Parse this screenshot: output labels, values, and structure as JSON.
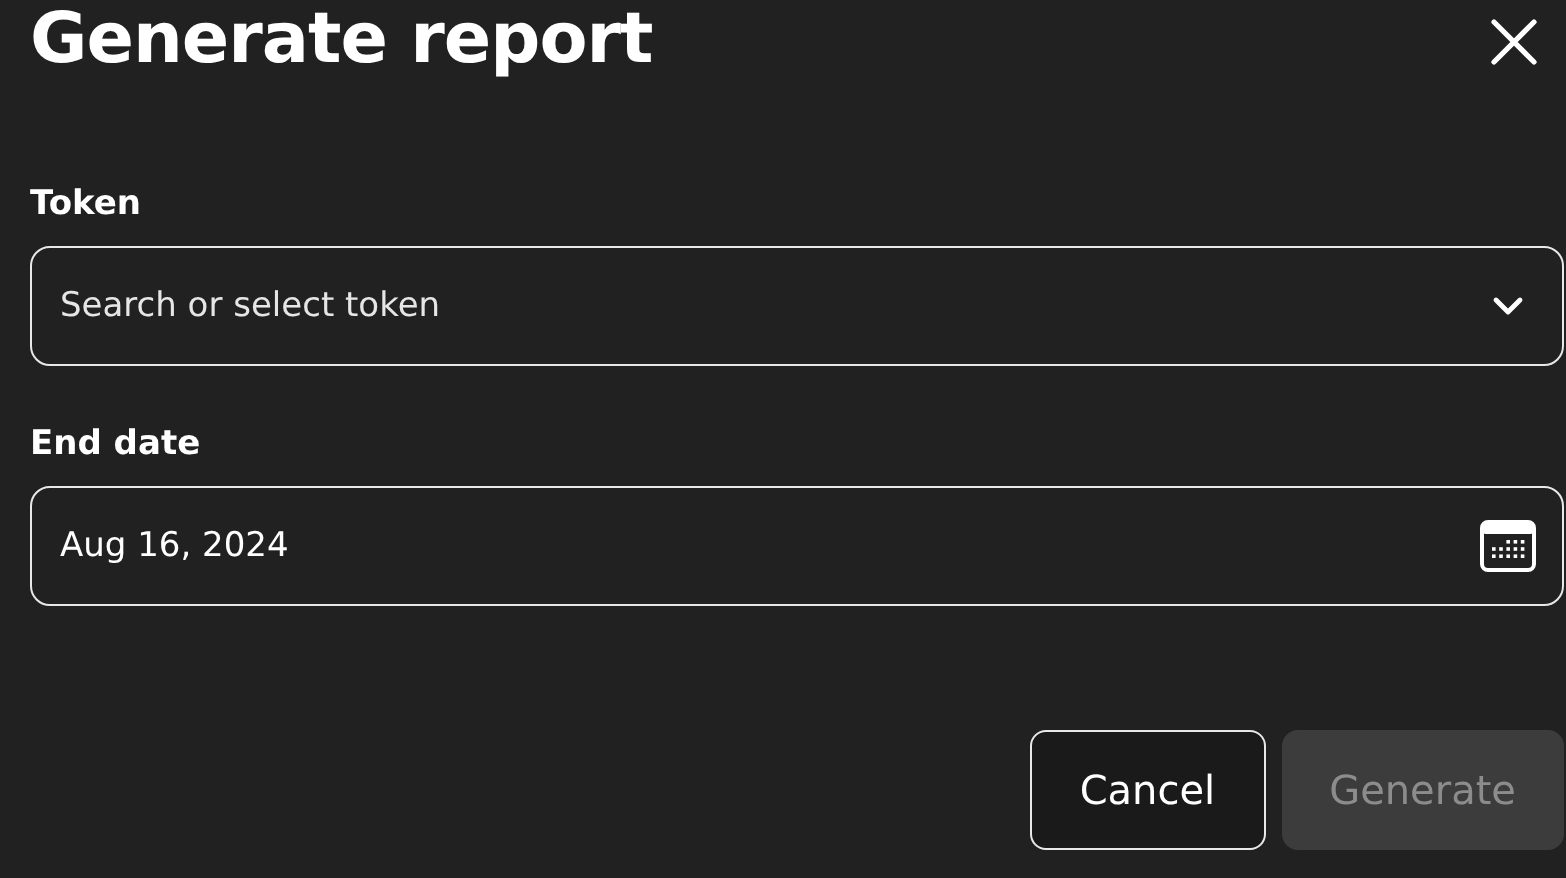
{
  "dialog": {
    "title": "Generate report",
    "fields": [
      {
        "kind": "select",
        "label": "Token",
        "placeholder": "Search or select token"
      },
      {
        "kind": "date",
        "label": "End date",
        "value": "Aug 16, 2024"
      }
    ],
    "buttons": [
      {
        "kind": "secondary",
        "label": "Cancel",
        "disabled": false
      },
      {
        "kind": "primary",
        "label": "Generate",
        "disabled": true
      }
    ]
  }
}
